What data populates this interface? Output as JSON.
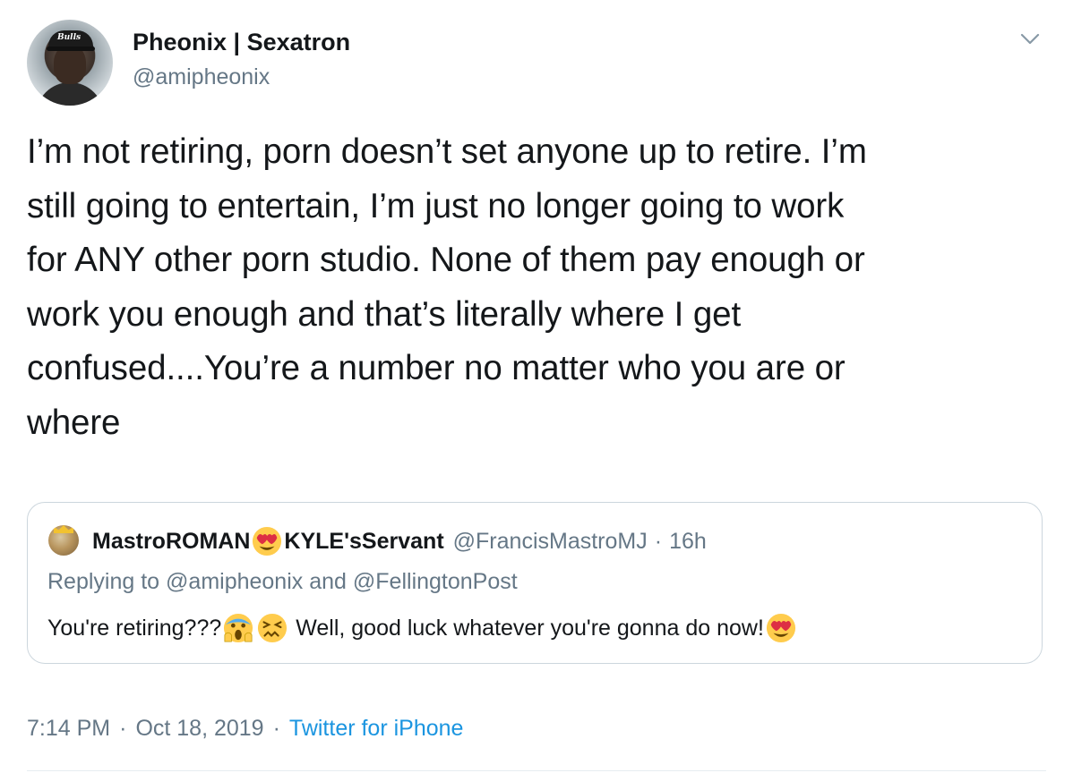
{
  "author": {
    "display_name": "Pheonix | Sexatron",
    "handle": "@amipheonix",
    "avatar_cap_text": "Bulls"
  },
  "menu_icon": "chevron-down-icon",
  "tweet_text": "I’m not retiring, porn doesn’t set anyone up to retire. I’m\nstill going to entertain, I’m just no longer going to work\nfor ANY other porn studio. None of them pay enough or\nwork you enough and that’s literally where I get\nconfused....You’re a number no matter who you are or\nwhere",
  "quoted_tweet": {
    "name_part1": "MastroROMAN",
    "name_emoji": "heart-eyes-emoji",
    "name_part2": "KYLE'sServant",
    "handle": "@FrancisMastroMJ",
    "separator": "·",
    "age": "16h",
    "replying_prefix": "Replying to",
    "replying_user1": "@amipheonix",
    "replying_and": "and",
    "replying_user2": "@FellingtonPost",
    "text_part1": "You're retiring???",
    "emoji_1": "face-screaming-emoji",
    "emoji_2": "confounded-face-emoji",
    "text_part2": " Well, good luck whatever you're gonna do now!",
    "emoji_3": "heart-eyes-emoji"
  },
  "footer": {
    "time": "7:14 PM",
    "separator": "·",
    "date": "Oct 18, 2019",
    "source": "Twitter for iPhone"
  },
  "colors": {
    "text": "#14171a",
    "secondary": "#657786",
    "link": "#1b95e0",
    "border": "#ccd6dd"
  }
}
